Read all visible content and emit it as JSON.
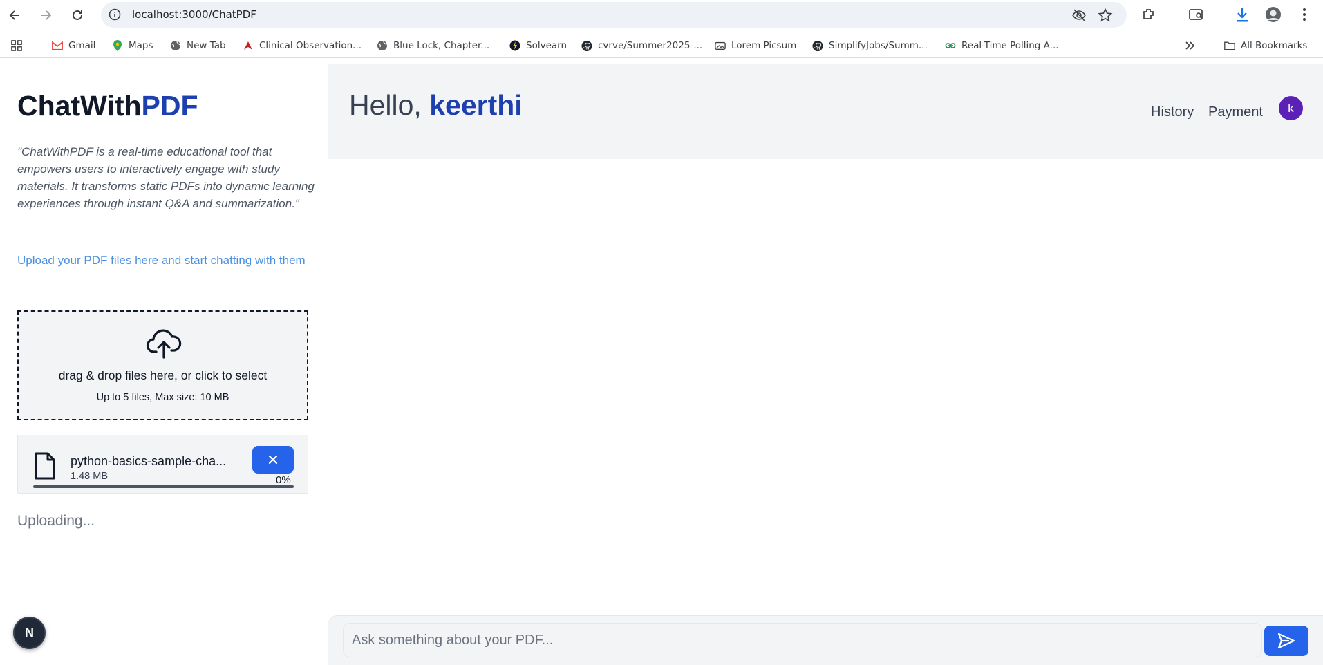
{
  "browser": {
    "url": "localhost:3000/ChatPDF",
    "bookmarks": [
      {
        "label": "Gmail",
        "icon": "gmail-icon"
      },
      {
        "label": "Maps",
        "icon": "maps-icon"
      },
      {
        "label": "New Tab",
        "icon": "globe-icon"
      },
      {
        "label": "Clinical Observation...",
        "icon": "bookmark-icon"
      },
      {
        "label": "Blue Lock, Chapter...",
        "icon": "globe-icon"
      },
      {
        "label": "Solvearn",
        "icon": "solvearn-icon"
      },
      {
        "label": "cvrve/Summer2025-...",
        "icon": "github-icon"
      },
      {
        "label": "Lorem Picsum",
        "icon": "image-icon"
      },
      {
        "label": "SimplifyJobs/Summ...",
        "icon": "github-icon"
      },
      {
        "label": "Real-Time Polling A...",
        "icon": "link-icon"
      }
    ],
    "all_bookmarks": "All Bookmarks"
  },
  "sidebar": {
    "title_part1": "ChatWith",
    "title_part2": "PDF",
    "tagline": "\"ChatWithPDF is a real-time educational tool that empowers users to interactively engage with study materials. It transforms static PDFs into dynamic learning experiences through instant Q&A and summarization.\"",
    "upload_prompt": "Upload your PDF files here and start chatting with them",
    "dropzone": {
      "title": "drag & drop files here, or click to select",
      "subtitle": "Up to 5 files, Max size: 10 MB"
    },
    "file": {
      "name": "python-basics-sample-cha...",
      "size": "1.48 MB",
      "progress_label": "0%",
      "progress": 0
    },
    "status": "Uploading..."
  },
  "header": {
    "greeting": "Hello,",
    "username": "keerthi",
    "nav": [
      "History",
      "Payment"
    ],
    "avatar_initial": "k"
  },
  "chat": {
    "placeholder": "Ask something about your PDF..."
  },
  "badge": "N",
  "colors": {
    "accent": "#1e40af",
    "primary_button": "#2563eb",
    "link": "#4a90e2",
    "avatar": "#5b21b6"
  }
}
